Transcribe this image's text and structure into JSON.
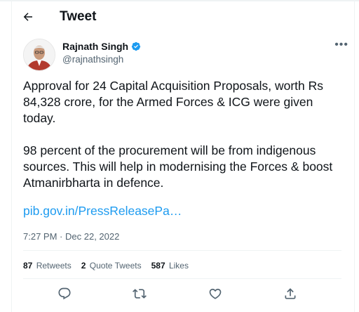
{
  "header": {
    "title": "Tweet"
  },
  "author": {
    "display_name": "Rajnath Singh",
    "handle": "@rajnathsingh",
    "verified_color": "#1d9bf0"
  },
  "tweet": {
    "paragraphs": [
      "Approval for 24 Capital Acquisition Proposals, worth Rs 84,328 crore, for the Armed Forces & ICG were given today.",
      "98 percent of the procurement will be from indigenous sources. This will help in modernising the Forces & boost Atmanirbharta in defence."
    ],
    "link": "pib.gov.in/PressReleasePa…"
  },
  "meta": {
    "time": "7:27 PM",
    "separator": "·",
    "date": "Dec 22, 2022"
  },
  "stats": {
    "retweets_count": "87",
    "retweets_label": "Retweets",
    "quotes_count": "2",
    "quotes_label": "Quote Tweets",
    "likes_count": "587",
    "likes_label": "Likes"
  },
  "colors": {
    "link": "#1d9bf0",
    "muted": "#536471",
    "text": "#0f1419"
  }
}
